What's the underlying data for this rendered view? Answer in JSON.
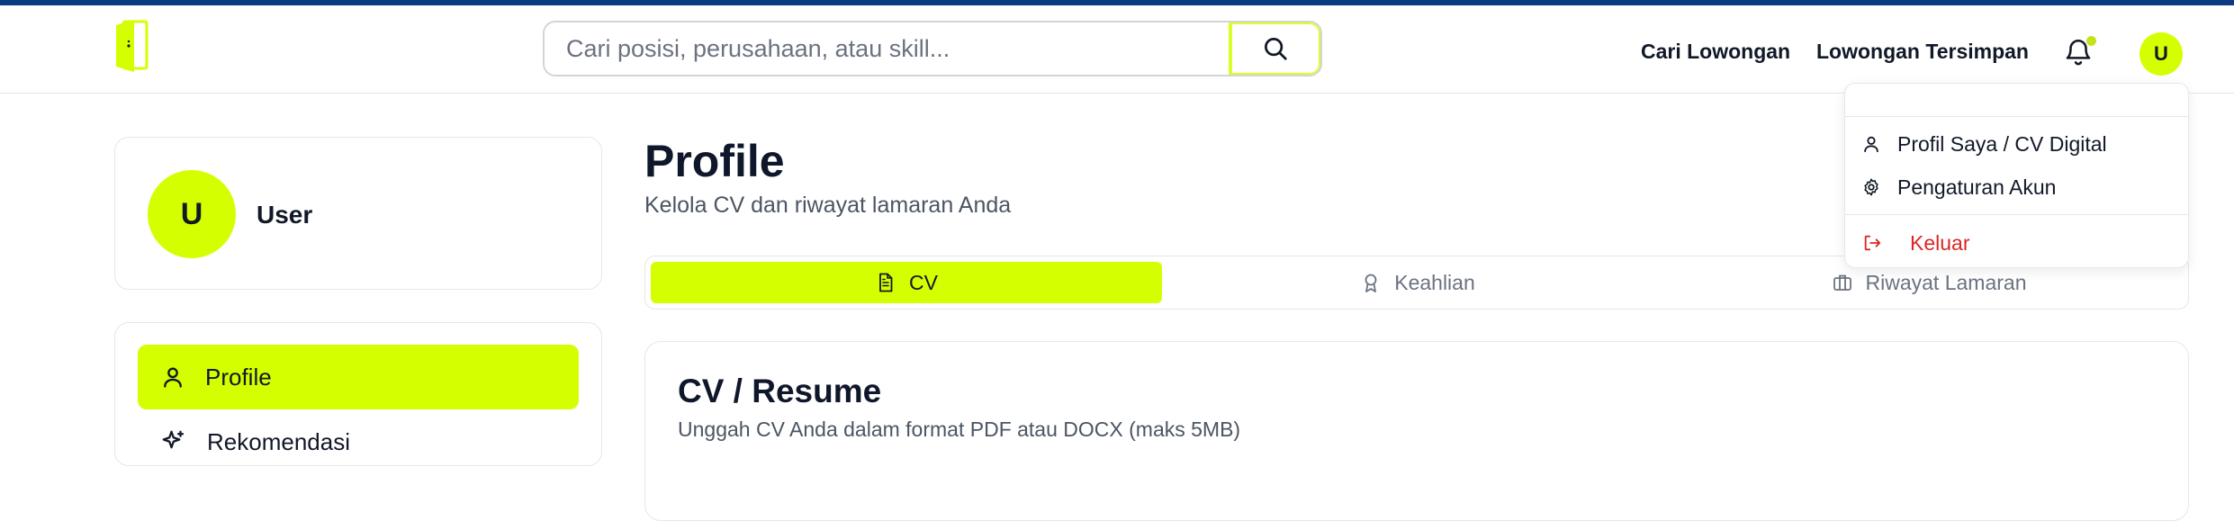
{
  "header": {
    "search_placeholder": "Cari posisi, perusahaan, atau skill...",
    "nav": {
      "jobs_label": "Cari Lowongan",
      "saved_label": "Lowongan Tersimpan"
    },
    "avatar_initial": "U"
  },
  "sidebar": {
    "avatar_initial": "U",
    "user_name": "User",
    "items": [
      {
        "label": "Profile",
        "icon": "user-icon",
        "active": true
      },
      {
        "label": "Rekomendasi",
        "icon": "sparkles-icon",
        "active": false
      }
    ]
  },
  "main": {
    "title": "Profile",
    "subtitle": "Kelola CV dan riwayat lamaran Anda",
    "tabs": [
      {
        "label": "CV",
        "icon": "document-icon",
        "active": true
      },
      {
        "label": "Keahlian",
        "icon": "award-icon",
        "active": false
      },
      {
        "label": "Riwayat Lamaran",
        "icon": "briefcase-icon",
        "active": false
      }
    ],
    "cv_card": {
      "title": "CV / Resume",
      "subtitle": "Unggah CV Anda dalam format PDF atau DOCX (maks 5MB)"
    }
  },
  "dropdown": {
    "items": [
      {
        "label": "Profil Saya / CV Digital",
        "icon": "user-icon"
      },
      {
        "label": "Pengaturan Akun",
        "icon": "gear-icon"
      },
      {
        "label": "Keluar",
        "icon": "logout-icon"
      }
    ]
  },
  "colors": {
    "accent": "#d4ff00",
    "top_border": "#0b3a82",
    "danger": "#dc2626"
  }
}
